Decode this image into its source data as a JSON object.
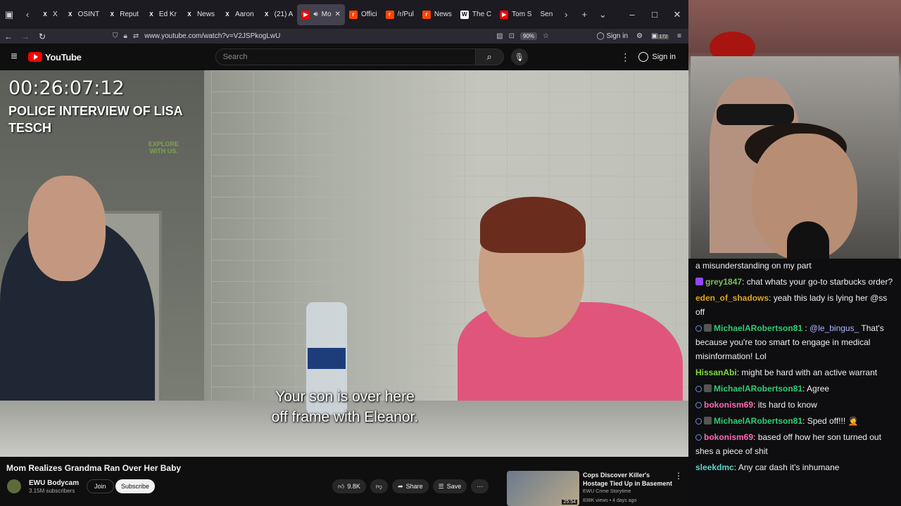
{
  "browser": {
    "tabs": [
      {
        "label": "X",
        "fav": "X",
        "color": "#1c1b22"
      },
      {
        "label": "OSINT",
        "fav": "X",
        "color": "#1c1b22"
      },
      {
        "label": "Reput",
        "fav": "X",
        "color": "#1c1b22"
      },
      {
        "label": "Ed Kr",
        "fav": "X",
        "color": "#1c1b22"
      },
      {
        "label": "News",
        "fav": "X",
        "color": "#1c1b22"
      },
      {
        "label": "Aaron",
        "fav": "X",
        "color": "#1c1b22"
      },
      {
        "label": "(21) A",
        "fav": "X",
        "color": "#1c1b22"
      },
      {
        "label": "Mo",
        "fav": "▶",
        "color": "#ff0000"
      },
      {
        "label": "Offici",
        "fav": "r",
        "color": "#ff4500"
      },
      {
        "label": "/r/Pul",
        "fav": "r",
        "color": "#ff4500"
      },
      {
        "label": "News",
        "fav": "r",
        "color": "#ff4500"
      },
      {
        "label": "The C",
        "fav": "W",
        "color": "#ffffff"
      },
      {
        "label": "Tom S",
        "fav": "▶",
        "color": "#ff0000"
      },
      {
        "label": "Sen",
        "fav": "",
        "color": "#1c1b22"
      }
    ],
    "url": "www.youtube.com/watch?v=V2JSPkogLwU",
    "zoom": "90%",
    "signin": "Sign in",
    "badge": "172"
  },
  "youtube": {
    "logo": "YouTube",
    "search_placeholder": "Search",
    "signin": "Sign in"
  },
  "video": {
    "timecode": "00:26:07:12",
    "overlay_title": "POLICE INTERVIEW OF LISA TESCH",
    "watermark": "EXPLORE WITH US.",
    "subtitle_line1": "Your son is over here",
    "subtitle_line2": "off frame with Eleanor."
  },
  "meta": {
    "title": "Mom Realizes Grandma Ran Over Her Baby",
    "channel": "EWU Bodycam",
    "subs": "3.15M subscribers",
    "join": "Join",
    "subscribe": "Subscribe",
    "likes": "9.8K",
    "share": "Share",
    "save": "Save"
  },
  "recommended": {
    "title": "Cops Discover Killer's Hostage Tied Up in Basement",
    "channel": "EWU Crime Storytime",
    "meta": "838K views • 4 days ago",
    "duration": "25:54"
  },
  "chat": [
    {
      "user": "",
      "color": "#efeff1",
      "badges": [],
      "text": "a misunderstanding on my part"
    },
    {
      "user": "grey1847",
      "color": "#7cbf5a",
      "badges": [
        "p"
      ],
      "text": ": chat whats your go-to starbucks order?"
    },
    {
      "user": "eden_of_shadows",
      "color": "#daa520",
      "badges": [],
      "text": ": yeah this lady is lying her @ss off"
    },
    {
      "user": "MichaelARobertson81",
      "color": "#2ecc71",
      "badges": [
        "person",
        "g"
      ],
      "mention": "@le_bingus_",
      "text": " That's because you're too smart to engage in medical misinformation! Lol"
    },
    {
      "user": "HissanAbi",
      "color": "#7ddc3a",
      "badges": [],
      "text": ": might be hard with an active warrant"
    },
    {
      "user": "MichaelARobertson81",
      "color": "#2ecc71",
      "badges": [
        "person",
        "g"
      ],
      "text": ": Agree"
    },
    {
      "user": "bokonism69",
      "color": "#ff69b4",
      "badges": [
        "person"
      ],
      "text": ": its hard to know"
    },
    {
      "user": "MichaelARobertson81",
      "color": "#2ecc71",
      "badges": [
        "person",
        "g"
      ],
      "text": ": Sped off!!! 🤦"
    },
    {
      "user": "bokonism69",
      "color": "#ff69b4",
      "badges": [
        "person"
      ],
      "text": ": based off how her son turned out shes a piece of shit"
    },
    {
      "user": "sleekdmc",
      "color": "#5fd3c9",
      "badges": [],
      "text": ": Any car dash it's inhumane"
    }
  ]
}
